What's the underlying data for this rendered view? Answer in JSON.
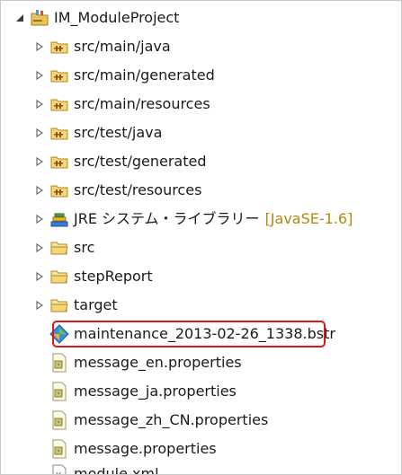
{
  "tree": {
    "project": {
      "label": "IM_ModuleProject",
      "icon": "java-project-icon"
    },
    "items": [
      {
        "label": "src/main/java",
        "icon": "source-folder-icon",
        "expander": "collapsed"
      },
      {
        "label": "src/main/generated",
        "icon": "source-folder-icon",
        "expander": "collapsed"
      },
      {
        "label": "src/main/resources",
        "icon": "source-folder-icon",
        "expander": "collapsed"
      },
      {
        "label": "src/test/java",
        "icon": "source-folder-icon",
        "expander": "collapsed"
      },
      {
        "label": "src/test/generated",
        "icon": "source-folder-icon",
        "expander": "collapsed"
      },
      {
        "label": "src/test/resources",
        "icon": "source-folder-icon",
        "expander": "collapsed"
      },
      {
        "label": "JRE システム・ライブラリー",
        "decoration": "[JavaSE-1.6]",
        "icon": "library-icon",
        "expander": "collapsed"
      },
      {
        "label": "src",
        "icon": "folder-icon",
        "expander": "collapsed"
      },
      {
        "label": "stepReport",
        "icon": "folder-icon",
        "expander": "collapsed"
      },
      {
        "label": "target",
        "icon": "folder-icon",
        "expander": "collapsed"
      },
      {
        "label": "maintenance_2013-02-26_1338.bstr",
        "icon": "bstr-file-icon",
        "highlighted": true
      },
      {
        "label": "message_en.properties",
        "icon": "properties-file-icon"
      },
      {
        "label": "message_ja.properties",
        "icon": "properties-file-icon"
      },
      {
        "label": "message_zh_CN.properties",
        "icon": "properties-file-icon"
      },
      {
        "label": "message.properties",
        "icon": "properties-file-icon"
      },
      {
        "label": "module.xml",
        "icon": "xml-file-icon"
      }
    ]
  },
  "colors": {
    "highlight_border": "#d81818",
    "decoration_text": "#b8860b"
  }
}
